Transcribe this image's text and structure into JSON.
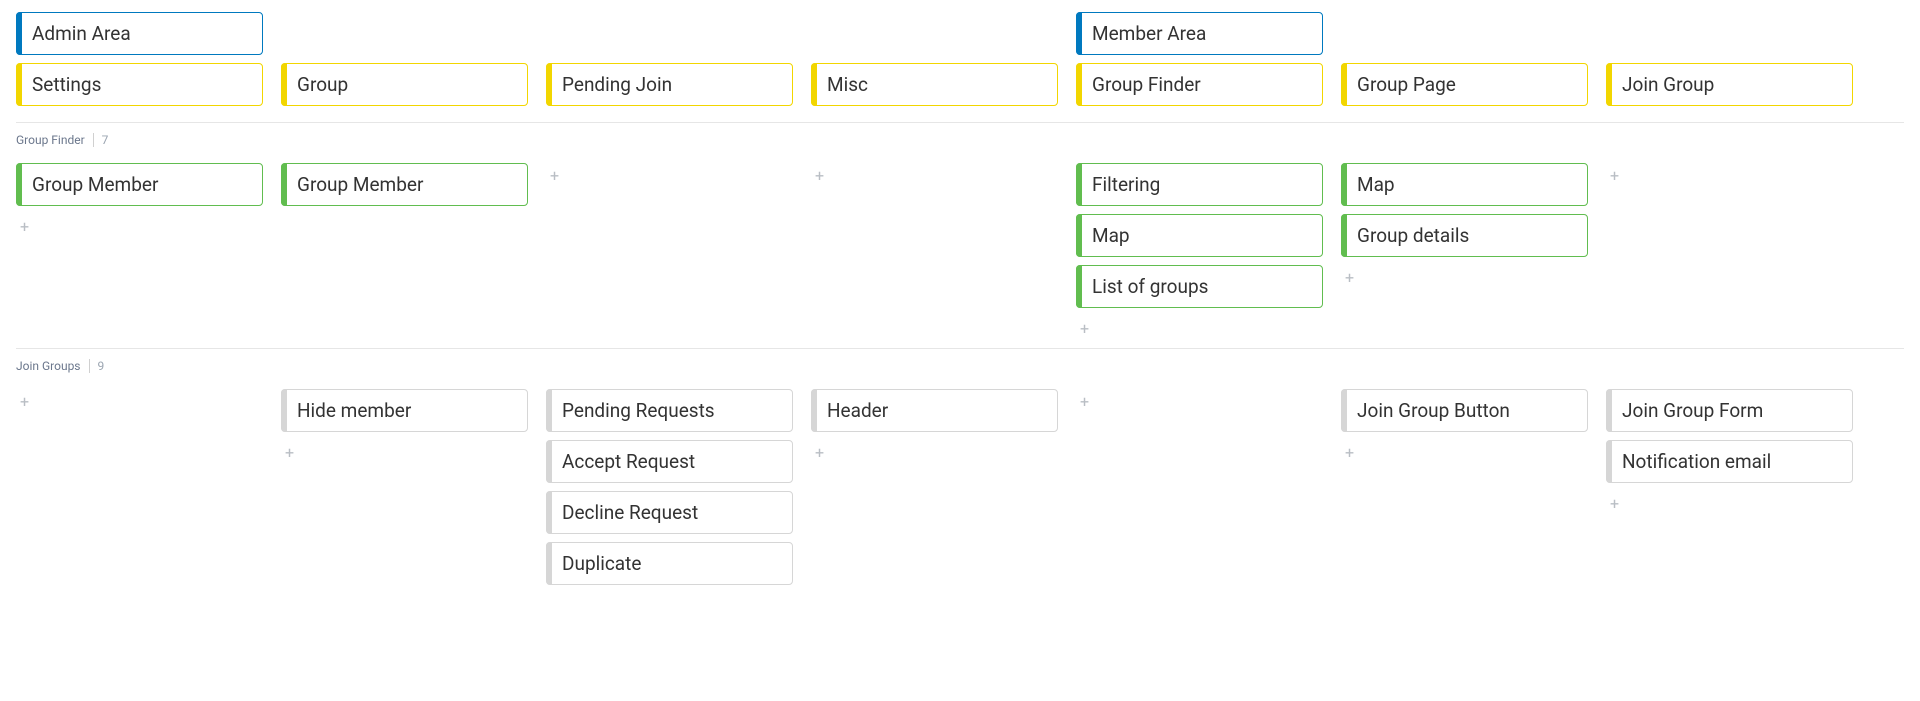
{
  "top": {
    "columns": [
      {
        "cards": [
          {
            "label": "Admin Area",
            "color": "blue"
          },
          {
            "label": "Settings",
            "color": "yellow"
          }
        ]
      },
      {
        "cards": [
          {
            "label": "Group",
            "color": "yellow"
          }
        ]
      },
      {
        "cards": [
          {
            "label": "Pending Join",
            "color": "yellow"
          }
        ]
      },
      {
        "cards": [
          {
            "label": "Misc",
            "color": "yellow"
          }
        ]
      },
      {
        "cards": [
          {
            "label": "Member Area",
            "color": "blue"
          },
          {
            "label": "Group Finder",
            "color": "yellow"
          }
        ]
      },
      {
        "cards": [
          {
            "label": "Group Page",
            "color": "yellow"
          }
        ]
      },
      {
        "cards": [
          {
            "label": "Join Group",
            "color": "yellow"
          }
        ]
      }
    ]
  },
  "section1": {
    "title": "Group Finder",
    "count": "7",
    "columns": [
      {
        "cards": [
          {
            "label": "Group Member",
            "color": "green"
          }
        ],
        "trailingAdd": true
      },
      {
        "cards": [
          {
            "label": "Group Member",
            "color": "green"
          }
        ]
      },
      {
        "cards": [],
        "placeholderAdd": true
      },
      {
        "cards": [],
        "placeholderAdd": true
      },
      {
        "cards": [
          {
            "label": "Filtering",
            "color": "green"
          },
          {
            "label": "Map",
            "color": "green"
          },
          {
            "label": "List of groups",
            "color": "green"
          }
        ],
        "trailingAdd": true
      },
      {
        "cards": [
          {
            "label": "Map",
            "color": "green"
          },
          {
            "label": "Group details",
            "color": "green"
          }
        ],
        "trailingAdd": true
      },
      {
        "cards": [],
        "placeholderAdd": true
      }
    ]
  },
  "section2": {
    "title": "Join Groups",
    "count": "9",
    "columns": [
      {
        "cards": [],
        "placeholderAdd": true
      },
      {
        "cards": [
          {
            "label": "Hide member",
            "color": "gray"
          }
        ],
        "trailingAdd": true
      },
      {
        "cards": [
          {
            "label": "Pending Requests",
            "color": "gray"
          },
          {
            "label": "Accept Request",
            "color": "gray"
          },
          {
            "label": "Decline Request",
            "color": "gray"
          },
          {
            "label": "Duplicate",
            "color": "gray"
          }
        ]
      },
      {
        "cards": [
          {
            "label": "Header",
            "color": "gray"
          }
        ],
        "trailingAdd": true
      },
      {
        "cards": [],
        "placeholderAdd": true
      },
      {
        "cards": [
          {
            "label": "Join Group Button",
            "color": "gray"
          }
        ],
        "trailingAdd": true
      },
      {
        "cards": [
          {
            "label": "Join Group Form",
            "color": "gray"
          },
          {
            "label": "Notification email",
            "color": "gray"
          }
        ],
        "trailingAdd": true
      }
    ]
  }
}
